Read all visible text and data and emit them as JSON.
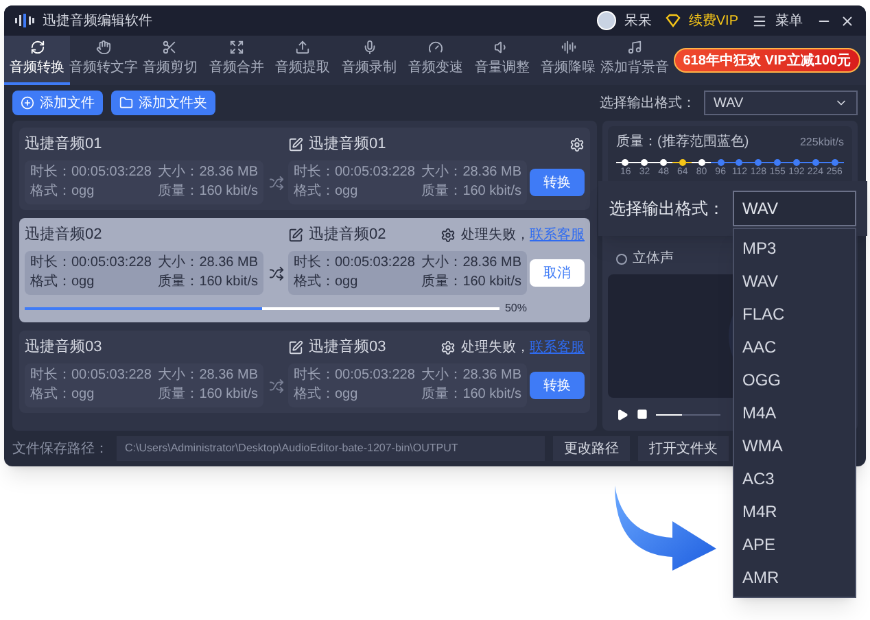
{
  "window": {
    "title": "迅捷音频编辑软件",
    "user": "呆呆",
    "vip": "续费VIP",
    "menu": "菜单"
  },
  "tabs": [
    {
      "label": "音频转换",
      "selected": true
    },
    {
      "label": "音频转文字",
      "selected": false
    },
    {
      "label": "音频剪切",
      "selected": false
    },
    {
      "label": "音频合并",
      "selected": false
    },
    {
      "label": "音频提取",
      "selected": false
    },
    {
      "label": "音频录制",
      "selected": false
    },
    {
      "label": "音频变速",
      "selected": false
    },
    {
      "label": "音量调整",
      "selected": false
    },
    {
      "label": "音频降噪",
      "selected": false
    },
    {
      "label": "添加背景音",
      "selected": false
    }
  ],
  "promo": "618年中狂欢 VIP立减100元",
  "toolbar": {
    "buttons": [
      "添加文件",
      "添加文件夹"
    ],
    "format_label": "选择输出格式：",
    "format_value": "WAV"
  },
  "tasks": [
    {
      "name": "迅捷音频01",
      "output_name": "迅捷音频01",
      "selected": false,
      "source": [
        "时长：00:05:03:228",
        "大小：28.36 MB",
        "格式：ogg",
        "质量：160 kbit/s"
      ],
      "target": [
        "时长：00:05:03:228",
        "大小：28.36 MB",
        "格式：ogg",
        "质量：160 kbit/s"
      ],
      "button": {
        "label": "转换",
        "kind": "primary"
      }
    },
    {
      "name": "迅捷音频02",
      "output_name": "迅捷音频02",
      "selected": true,
      "source": [
        "时长：00:05:03:228",
        "大小：28.36 MB",
        "格式：ogg",
        "质量：160 kbit/s"
      ],
      "target": [
        "时长：00:05:03:228",
        "大小：28.36 MB",
        "格式：ogg",
        "质量：160 kbit/s"
      ],
      "status": "处理失败，",
      "status_link": "联系客服",
      "button": {
        "label": "取消",
        "kind": "secondary"
      },
      "progress": {
        "level": 0.5,
        "reading": "50%"
      }
    },
    {
      "name": "迅捷音频03",
      "output_name": "迅捷音频03",
      "selected": false,
      "source": [
        "时长：00:05:03:228",
        "大小：28.36 MB",
        "格式：ogg",
        "质量：160 kbit/s"
      ],
      "target": [
        "时长：00:05:03:228",
        "大小：28.36 MB",
        "格式：ogg",
        "质量：160 kbit/s"
      ],
      "status": "处理失败，",
      "status_link": "联系客服",
      "button": {
        "label": "转换",
        "kind": "primary"
      }
    }
  ],
  "quality": {
    "label": "质量：(推荐范围蓝色)",
    "reading": "225kbit/s",
    "ticks": [
      {
        "label": "16",
        "color": "#ffffff"
      },
      {
        "label": "32",
        "color": "#ffffff"
      },
      {
        "label": "48",
        "color": "#ffffff"
      },
      {
        "label": "64",
        "color": "#f5c518"
      },
      {
        "label": "80",
        "color": "#ffffff"
      },
      {
        "label": "96",
        "color": "#3f7bf6"
      },
      {
        "label": "112",
        "color": "#3f7bf6"
      },
      {
        "label": "128",
        "color": "#3f7bf6"
      },
      {
        "label": "155",
        "color": "#3f7bf6"
      },
      {
        "label": "192",
        "color": "#3f7bf6"
      },
      {
        "label": "224",
        "color": "#3f7bf6"
      },
      {
        "label": "256",
        "color": "#3f7bf6"
      }
    ]
  },
  "stereo": {
    "label": "立体声",
    "checked": false
  },
  "player": {
    "level": 0.4
  },
  "save_path": {
    "label": "文件保存路径：",
    "path": "C:\\Users\\Administrator\\Desktop\\AudioEditor-bate-1207-bin\\OUTPUT",
    "buttons": [
      "更改路径",
      "打开文件夹"
    ]
  },
  "popup": {
    "label": "选择输出格式：",
    "value": "WAV",
    "options": [
      "MP3",
      "WAV",
      "FLAC",
      "AAC",
      "OGG",
      "M4A",
      "WMA",
      "AC3",
      "M4R",
      "APE",
      "AMR"
    ]
  }
}
